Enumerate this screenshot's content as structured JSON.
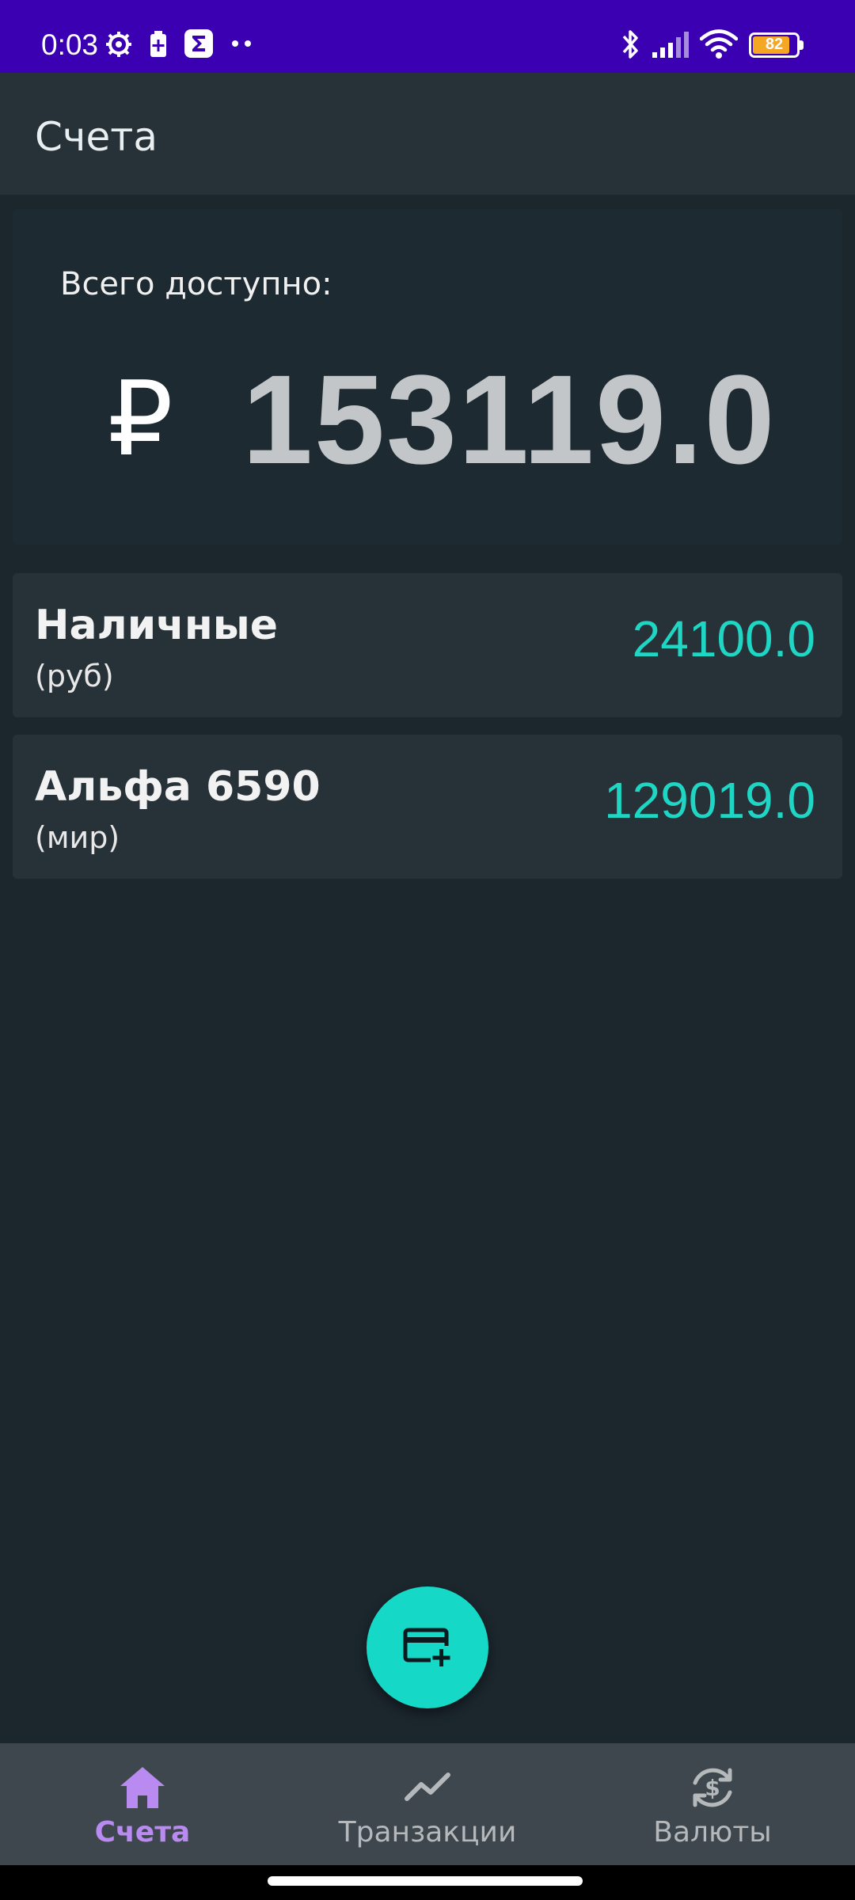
{
  "status_bar": {
    "time": "0:03",
    "battery_level": "82",
    "icons": [
      "gear-icon",
      "battery-saver-icon",
      "sigma-app-icon",
      "more-dots-icon",
      "bluetooth-icon",
      "signal-icon",
      "wifi-icon",
      "battery-icon"
    ],
    "background_color": "#3a00b2"
  },
  "app_bar": {
    "title": "Счета"
  },
  "summary": {
    "label": "Всего доступно:",
    "currency_symbol": "₽",
    "total": "153119.0"
  },
  "accounts": [
    {
      "name": "Наличные",
      "subtitle": "(руб)",
      "balance": "24100.0"
    },
    {
      "name": "Альфа 6590",
      "subtitle": "(мир)",
      "balance": "129019.0"
    }
  ],
  "fab": {
    "icon": "add-card-icon",
    "color": "#16d8c6"
  },
  "bottom_nav": {
    "items": [
      {
        "label": "Счета",
        "icon": "home-icon",
        "active": true
      },
      {
        "label": "Транзакции",
        "icon": "trending-icon",
        "active": false
      },
      {
        "label": "Валюты",
        "icon": "currency-exchange-icon",
        "active": false
      }
    ]
  },
  "colors": {
    "accent_teal": "#1ed6c3",
    "active_nav": "#b98af0",
    "background": "#1b262d"
  }
}
